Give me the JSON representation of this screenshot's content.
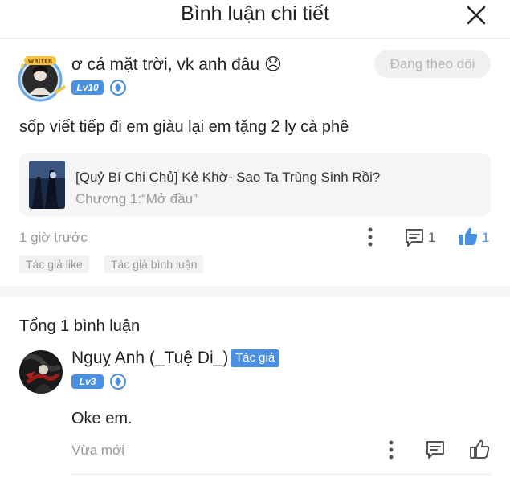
{
  "header": {
    "title": "Bình luận chi tiết",
    "close_icon": "close-icon"
  },
  "comment": {
    "avatar_badge": "WRITER",
    "username": "ơ cá mặt trời, vk anh đâu 😞",
    "level": "Lv10",
    "gem_icon": "diamond-icon",
    "follow_label": "Đang theo dõi",
    "text": "sốp viết tiếp đi em giàu lại em tặng 2 ly cà phê",
    "book": {
      "title": "[Quỷ Bí Chi Chủ] Kẻ Khờ- Sao Ta Trùng Sinh Rồi?",
      "chapter": "Chương 1:“Mở đầu”"
    },
    "time": "1 giờ trước",
    "reply_count": "1",
    "like_count": "1",
    "tags": [
      "Tác giả like",
      "Tác giả bình luận"
    ]
  },
  "replies_section": {
    "total_label": "Tổng 1 bình luận",
    "reply": {
      "name": "Nguỵ Anh (_Tuệ Di_)",
      "author_badge": "Tác giả",
      "level": "Lv3",
      "text": "Oke em.",
      "time": "Vừa mới"
    }
  },
  "colors": {
    "accent": "#4a90e2",
    "muted": "#9a9a9a",
    "like_active": "#4a90e2"
  }
}
